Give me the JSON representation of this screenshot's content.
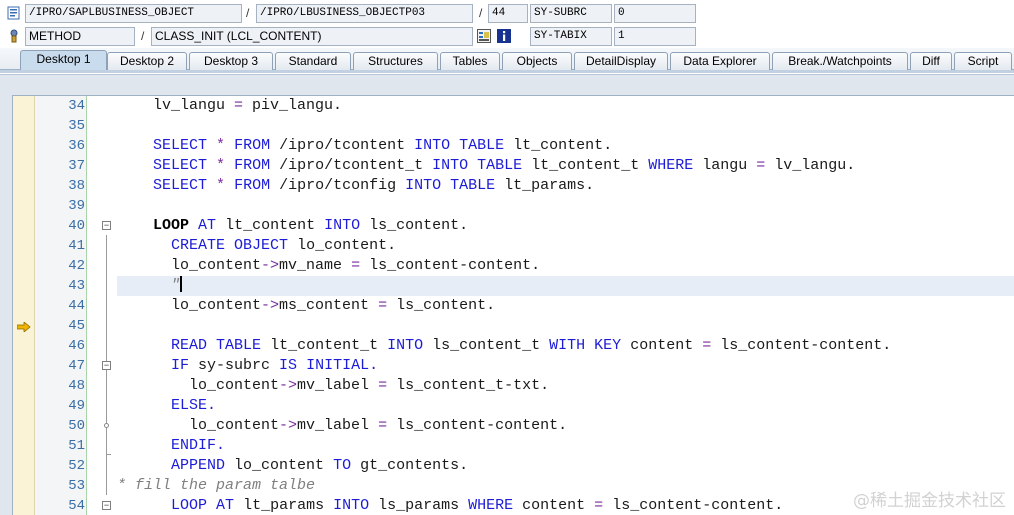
{
  "header": {
    "program": "/IPRO/SAPLBUSINESS_OBJECT",
    "include": "/IPRO/LBUSINESS_OBJECTP03",
    "line": "44",
    "sysvar1_name": "SY-SUBRC",
    "sysvar1_value": "0",
    "event_type": "METHOD",
    "event": "CLASS_INIT (LCL_CONTENT)",
    "sysvar2_name": "SY-TABIX",
    "sysvar2_value": "1",
    "slash": "/"
  },
  "tabs": [
    {
      "label": "Desktop 1",
      "active": true
    },
    {
      "label": "Desktop 2"
    },
    {
      "label": "Desktop 3"
    },
    {
      "label": "Standard"
    },
    {
      "label": "Structures"
    },
    {
      "label": "Tables"
    },
    {
      "label": "Objects"
    },
    {
      "label": "DetailDisplay"
    },
    {
      "label": "Data Explorer"
    },
    {
      "label": "Break./Watchpoints"
    },
    {
      "label": "Diff"
    },
    {
      "label": "Script"
    }
  ],
  "editor": {
    "current_line": "44",
    "lines": [
      {
        "n": "34"
      },
      {
        "n": "35"
      },
      {
        "n": "36"
      },
      {
        "n": "37"
      },
      {
        "n": "38"
      },
      {
        "n": "39"
      },
      {
        "n": "40"
      },
      {
        "n": "41"
      },
      {
        "n": "42"
      },
      {
        "n": "43"
      },
      {
        "n": "44"
      },
      {
        "n": "45"
      },
      {
        "n": "46"
      },
      {
        "n": "47"
      },
      {
        "n": "48"
      },
      {
        "n": "49"
      },
      {
        "n": "50"
      },
      {
        "n": "51"
      },
      {
        "n": "52"
      },
      {
        "n": "53"
      },
      {
        "n": "54"
      }
    ],
    "t": {
      "l34a": "    lv_langu ",
      "l34b": "=",
      "l34c": " piv_langu.",
      "l36a": "    ",
      "l36b": "SELECT",
      "l36c": " ",
      "l36d": "*",
      "l36e": " ",
      "l36f": "FROM",
      "l36g": " /ipro/tcontent ",
      "l36h": "INTO",
      "l36i": " ",
      "l36j": "TABLE",
      "l36k": " lt_content.",
      "l37a": "    ",
      "l37b": "SELECT",
      "l37c": " ",
      "l37d": "*",
      "l37e": " ",
      "l37f": "FROM",
      "l37g": " /ipro/tcontent_t ",
      "l37h": "INTO",
      "l37i": " ",
      "l37j": "TABLE",
      "l37k": " lt_content_t ",
      "l37l": "WHERE",
      "l37m": " langu ",
      "l37n": "=",
      "l37o": " lv_langu.",
      "l38a": "    ",
      "l38b": "SELECT",
      "l38c": " ",
      "l38d": "*",
      "l38e": " ",
      "l38f": "FROM",
      "l38g": " /ipro/tconfig ",
      "l38h": "INTO",
      "l38i": " ",
      "l38j": "TABLE",
      "l38k": " lt_params.",
      "l40a": "    ",
      "l40b": "LOOP",
      "l40c": " ",
      "l40d": "AT",
      "l40e": " lt_content ",
      "l40f": "INTO",
      "l40g": " ls_content.",
      "l41a": "      ",
      "l41b": "CREATE",
      "l41c": " ",
      "l41d": "OBJECT",
      "l41e": " lo_content.",
      "l42a": "      lo_content",
      "l42b": "->",
      "l42c": "mv_name ",
      "l42d": "=",
      "l42e": " ls_content-content.",
      "l43a": "      ",
      "l43b": "\"",
      "l44a": "      lo_content",
      "l44b": "->",
      "l44c": "ms_content ",
      "l44d": "=",
      "l44e": " ls_content.",
      "l46a": "      ",
      "l46b": "READ",
      "l46c": " ",
      "l46d": "TABLE",
      "l46e": " lt_content_t ",
      "l46f": "INTO",
      "l46g": " ls_content_t ",
      "l46h": "WITH",
      "l46i": " ",
      "l46j": "KEY",
      "l46k": " content ",
      "l46l": "=",
      "l46m": " ls_content-content.",
      "l47a": "      ",
      "l47b": "IF",
      "l47c": " sy-subrc ",
      "l47d": "IS",
      "l47e": " ",
      "l47f": "INITIAL",
      "l47g": ".",
      "l48a": "        lo_content",
      "l48b": "->",
      "l48c": "mv_label ",
      "l48d": "=",
      "l48e": " ls_content_t-txt.",
      "l49a": "      ",
      "l49b": "ELSE",
      "l49c": ".",
      "l50a": "        lo_content",
      "l50b": "->",
      "l50c": "mv_label ",
      "l50d": "=",
      "l50e": " ls_content-content.",
      "l51a": "      ",
      "l51b": "ENDIF",
      "l51c": ".",
      "l52a": "      ",
      "l52b": "APPEND",
      "l52c": " lo_content ",
      "l52d": "TO",
      "l52e": " gt_contents.",
      "l53a": "* fill the param talbe",
      "l54a": "      ",
      "l54b": "LOOP",
      "l54c": " ",
      "l54d": "AT",
      "l54e": " lt_params ",
      "l54f": "INTO",
      "l54g": " ls_params ",
      "l54h": "WHERE",
      "l54i": " content ",
      "l54j": "=",
      "l54k": " ls_content-content."
    }
  },
  "watermark": "@稀土掘金技术社区",
  "colors": {
    "keyword": "#1c1cd6",
    "operator": "#7a2b9e",
    "comment": "#808080",
    "line_number": "#3a6ea5",
    "current_line_bg": "#e6edf7",
    "active_tab": "#c9dced"
  }
}
